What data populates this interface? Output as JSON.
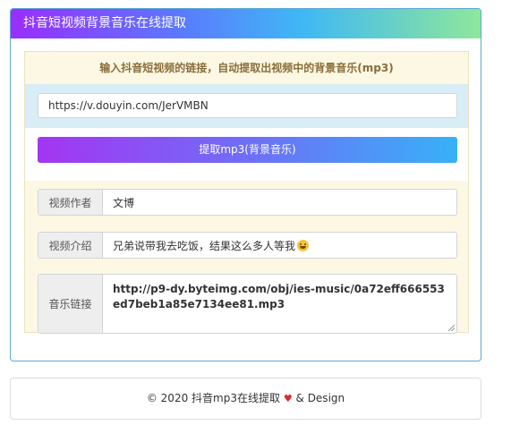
{
  "header": {
    "title": "抖音短视频背景音乐在线提取"
  },
  "intro": {
    "text": "输入抖音短视频的链接，自动提取出视频中的背景音乐(mp3)"
  },
  "url_input": {
    "value": "https://v.douyin.com/JerVMBN"
  },
  "extract_button": {
    "label": "提取mp3(背景音乐)"
  },
  "fields": {
    "author": {
      "label": "视频作者",
      "value": "文博"
    },
    "description": {
      "label": "视频介绍",
      "value": "兄弟说带我去吃饭，结果这么多人等我"
    },
    "music_link": {
      "label": "音乐链接",
      "value": "http://p9-dy.byteimg.com/obj/ies-music/0a72eff666553ed7beb1a85e7134ee81.mp3"
    }
  },
  "footer": {
    "copyright": "© 2020  抖音mp3在线提取",
    "heart": "♥",
    "design": "& Design"
  },
  "colors": {
    "heading_start": "#9a2cff",
    "heading_end": "#8ee79c",
    "panel_bg": "#fcf8e3",
    "url_row_bg": "#d9edf7",
    "heart": "#e0282e"
  }
}
